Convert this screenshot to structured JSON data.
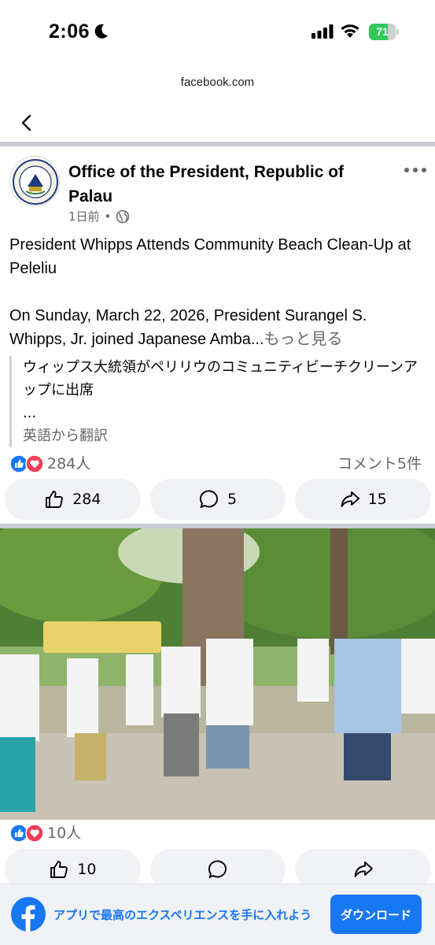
{
  "status_bar": {
    "time": "2:06",
    "battery_percent": 71,
    "battery_label": "71",
    "battery_color": "#34c759"
  },
  "browser": {
    "url": "facebook.com",
    "back_icon": "chevron-left-icon"
  },
  "post": {
    "page_name": "Office of the President, Republic of Palau",
    "time_ago": "1日前",
    "separator": "•",
    "audience_icon": "globe-icon",
    "title": "President Whipps Attends Community Beach Clean-Up at Peleliu",
    "body_preview": "On Sunday, March 22, 2026, President Surangel S. Whipps, Jr. joined Japanese Amba...",
    "see_more": "もっと見る",
    "translation": "ウィップス大統領がペリリウのコミュニティビーチクリーンアップに出席",
    "translation_ellipsis": "...",
    "translation_note": "英語から翻訳",
    "reactions_label": "284人",
    "comments_label": "コメント5件",
    "like_count": "284",
    "comment_count": "5",
    "share_count": "15",
    "reaction_icons": [
      "like-icon",
      "love-icon"
    ],
    "accent_color": "#1877f2"
  },
  "post2": {
    "reactions_label": "10人",
    "like_count": "10"
  },
  "banner": {
    "text": "アプリで最高のエクスペリエンスを手に入れよう",
    "button": "ダウンロード",
    "logo_icon": "facebook-logo-icon"
  }
}
